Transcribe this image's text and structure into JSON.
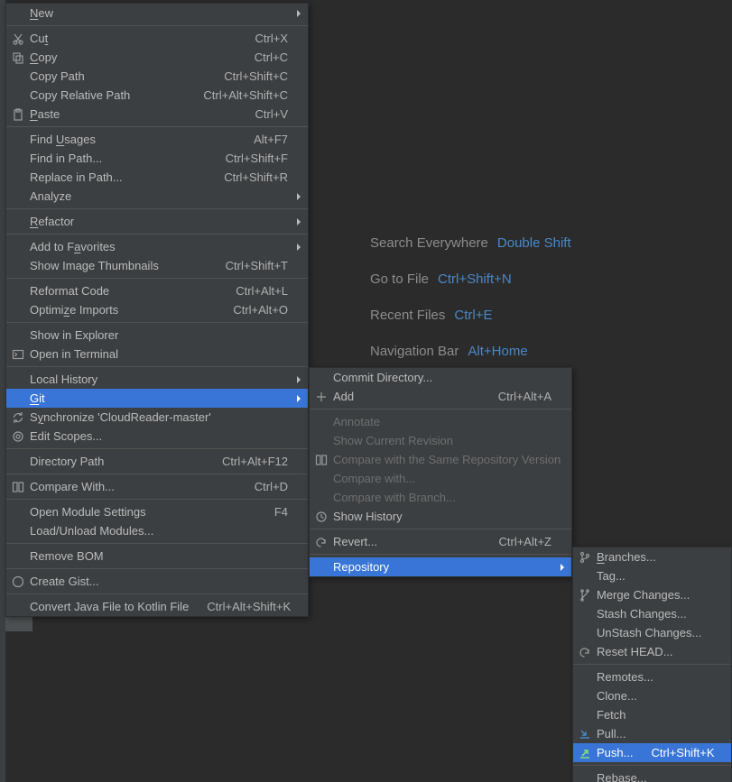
{
  "hints": {
    "search": {
      "label": "Search Everywhere",
      "kb": "Double Shift"
    },
    "gotofile": {
      "label": "Go to File",
      "kb": "Ctrl+Shift+N"
    },
    "recent": {
      "label": "Recent Files",
      "kb": "Ctrl+E"
    },
    "navbar": {
      "label": "Navigation Bar",
      "kb": "Alt+Home"
    }
  },
  "main": {
    "new": "New",
    "cut": {
      "pre": "Cu",
      "mn": "t",
      "post": "",
      "sc": "Ctrl+X"
    },
    "copy": {
      "mn": "C",
      "post": "opy",
      "sc": "Ctrl+C"
    },
    "copypath": {
      "label": "Copy Path",
      "sc": "Ctrl+Shift+C"
    },
    "copyrelpath": {
      "label": "Copy Relative Path",
      "sc": "Ctrl+Alt+Shift+C"
    },
    "paste": {
      "mn": "P",
      "post": "aste",
      "sc": "Ctrl+V"
    },
    "findusages": {
      "pre": "Find ",
      "mn": "U",
      "post": "sages",
      "sc": "Alt+F7"
    },
    "findinpath": {
      "label": "Find in Path...",
      "sc": "Ctrl+Shift+F"
    },
    "replaceinpath": {
      "label": "Replace in Path...",
      "sc": "Ctrl+Shift+R"
    },
    "analyze": "Analyze",
    "refactor": {
      "mn": "R",
      "post": "efactor"
    },
    "addfav": {
      "pre": "Add to F",
      "mn": "a",
      "post": "vorites"
    },
    "thumbs": {
      "label": "Show Image Thumbnails",
      "sc": "Ctrl+Shift+T"
    },
    "reformat": {
      "label": "Reformat Code",
      "sc": "Ctrl+Alt+L"
    },
    "optimize": {
      "pre": "Optimi",
      "mn": "z",
      "post": "e Imports",
      "sc": "Ctrl+Alt+O"
    },
    "showexpl": "Show in Explorer",
    "openterm": "Open in Terminal",
    "localhist": "Local History",
    "git": {
      "mn": "G",
      "post": "it"
    },
    "sync": {
      "pre": "S",
      "mn": "y",
      "post": "nchronize 'CloudReader-master'"
    },
    "editscopes": "Edit Scopes...",
    "dirpath": {
      "label": "Directory Path",
      "sc": "Ctrl+Alt+F12"
    },
    "compare": {
      "label": "Compare With...",
      "sc": "Ctrl+D"
    },
    "openmod": {
      "label": "Open Module Settings",
      "sc": "F4"
    },
    "loadmod": "Load/Unload Modules...",
    "removebom": "Remove BOM",
    "gist": "Create Gist...",
    "convertkt": {
      "label": "Convert Java File to Kotlin File",
      "sc": "Ctrl+Alt+Shift+K"
    }
  },
  "git_menu": {
    "commit": "Commit Directory...",
    "add": {
      "label": "Add",
      "sc": "Ctrl+Alt+A"
    },
    "annotate": "Annotate",
    "showrev": "Show Current Revision",
    "comparesame": "Compare with the Same Repository Version",
    "comparewith": "Compare with...",
    "comparebranch": "Compare with Branch...",
    "showhist": "Show History",
    "revert": {
      "label": "Revert...",
      "sc": "Ctrl+Alt+Z"
    },
    "repository": "Repository"
  },
  "repo_menu": {
    "branches": {
      "mn": "B",
      "post": "ranches..."
    },
    "tag": "Tag...",
    "merge": "Merge Changes...",
    "stash": "Stash Changes...",
    "unstash": "UnStash Changes...",
    "reset": "Reset HEAD...",
    "remotes": "Remotes...",
    "clone": "Clone...",
    "fetch": "Fetch",
    "pull": "Pull...",
    "push": {
      "label": "Push...",
      "sc": "Ctrl+Shift+K"
    },
    "rebase": "Rebase..."
  }
}
